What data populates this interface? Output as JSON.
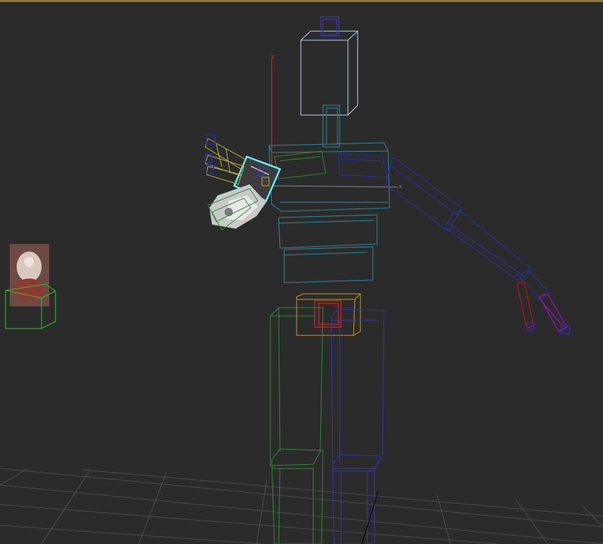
{
  "viewport": {
    "background": "#2b2b2b",
    "active_border_color": "#8a7a4a",
    "grid_color": "#4f4f4f"
  },
  "gizmo": {
    "z_label": "z",
    "x_label": "x",
    "z_color": "#c43c3c",
    "x_color": "#888888"
  },
  "colors": {
    "head": "#bcd6ee",
    "spine": "#2c8ea0",
    "left_arm": "#2b2fb0",
    "left_leg": "#2f8f2f",
    "right_leg": "#3434b8",
    "pelvis": "#c8a21c",
    "pelvis_inner": "#d01c1c",
    "hand_selection": "#5ff0f6",
    "fingers": "#b8b83a",
    "finger_tips": "#2a2ab8",
    "right_finger": "#a01818",
    "purple_finger": "#8a18a8",
    "helper": "#29c929"
  }
}
